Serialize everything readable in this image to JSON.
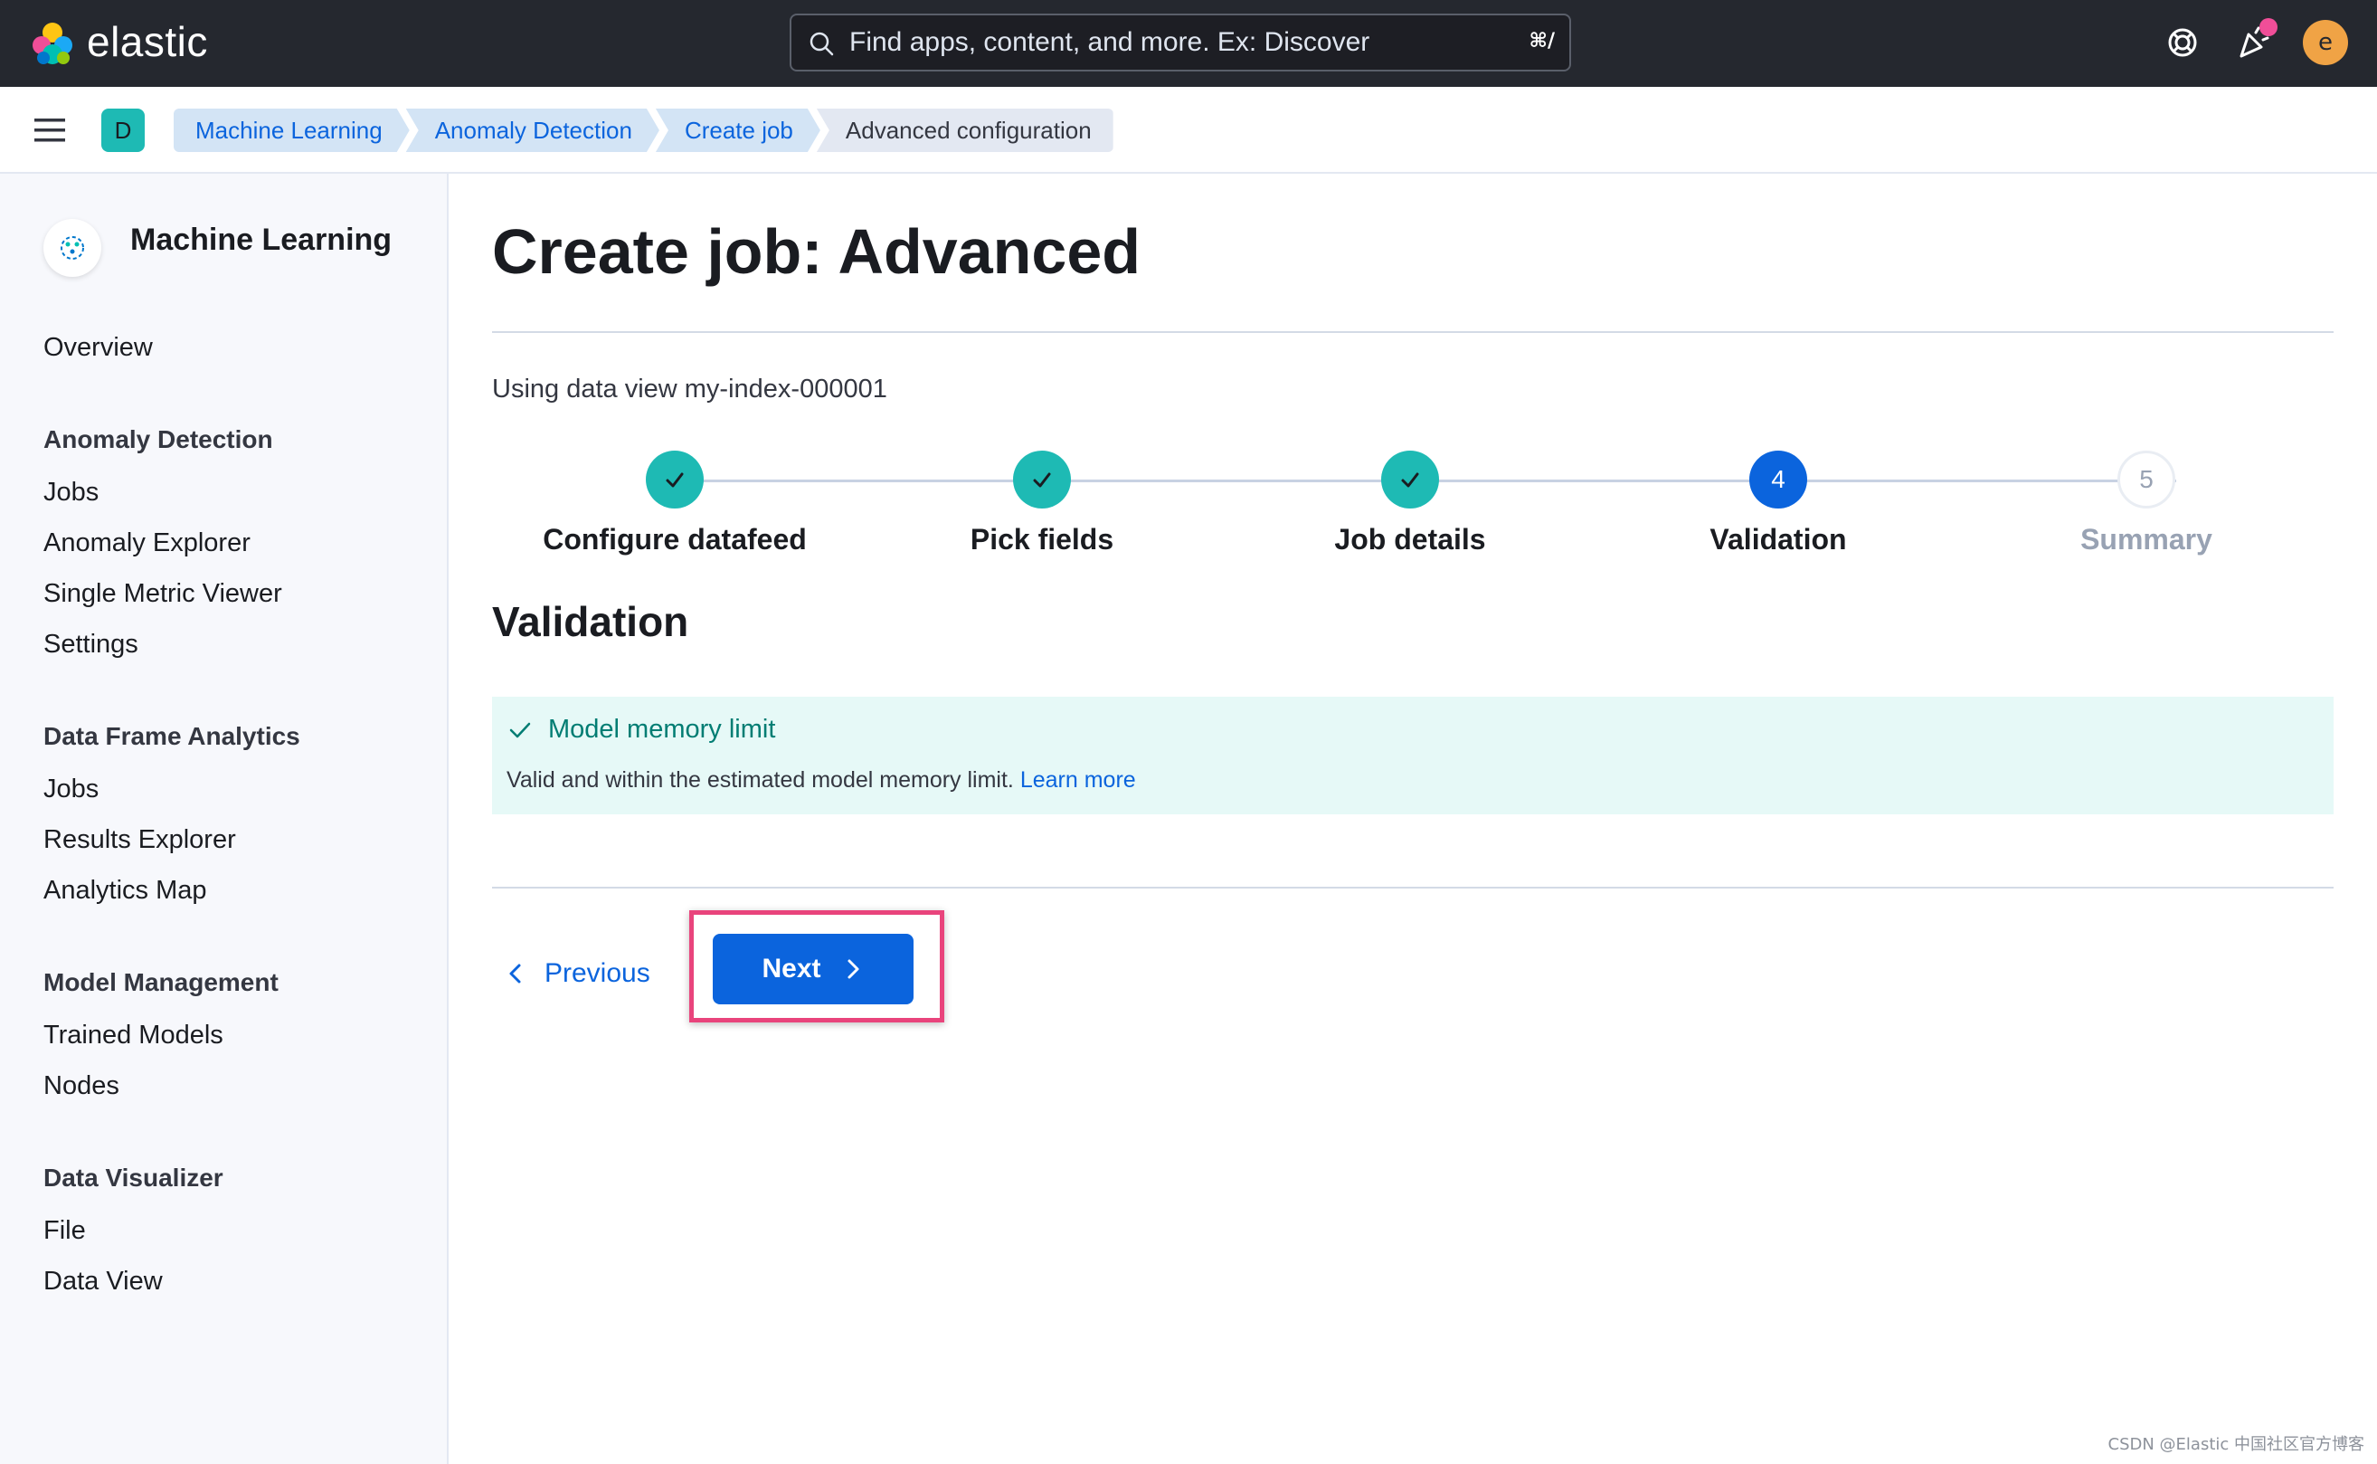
{
  "header": {
    "logo_text": "elastic",
    "search": {
      "placeholder": "Find apps, content, and more. Ex: Discover",
      "shortcut": "⌘/"
    },
    "avatar_initial": "e"
  },
  "breadcrumb": {
    "space_initial": "D",
    "items": [
      {
        "label": "Machine Learning"
      },
      {
        "label": "Anomaly Detection"
      },
      {
        "label": "Create job"
      },
      {
        "label": "Advanced configuration"
      }
    ]
  },
  "sidebar": {
    "title": "Machine Learning",
    "overview": "Overview",
    "groups": [
      {
        "title": "Anomaly Detection",
        "items": [
          "Jobs",
          "Anomaly Explorer",
          "Single Metric Viewer",
          "Settings"
        ]
      },
      {
        "title": "Data Frame Analytics",
        "items": [
          "Jobs",
          "Results Explorer",
          "Analytics Map"
        ]
      },
      {
        "title": "Model Management",
        "items": [
          "Trained Models",
          "Nodes"
        ]
      },
      {
        "title": "Data Visualizer",
        "items": [
          "File",
          "Data View"
        ]
      }
    ]
  },
  "main": {
    "title": "Create job: Advanced",
    "data_view_text": "Using data view my-index-000001",
    "steps": [
      {
        "label": "Configure datafeed",
        "status": "complete"
      },
      {
        "label": "Pick fields",
        "status": "complete"
      },
      {
        "label": "Job details",
        "status": "complete"
      },
      {
        "label": "Validation",
        "status": "current",
        "number": "4"
      },
      {
        "label": "Summary",
        "status": "incomplete",
        "number": "5"
      }
    ],
    "section_title": "Validation",
    "callout": {
      "title": "Model memory limit",
      "body": "Valid and within the estimated model memory limit.",
      "link": "Learn more"
    },
    "previous_label": "Previous",
    "next_label": "Next"
  },
  "watermark": "CSDN @Elastic 中国社区官方博客",
  "colors": {
    "header_bg": "#25282f",
    "primary": "#0b64dd",
    "success": "#1ebab4",
    "callout_bg": "#e6f9f7",
    "highlight": "#e9447c"
  }
}
